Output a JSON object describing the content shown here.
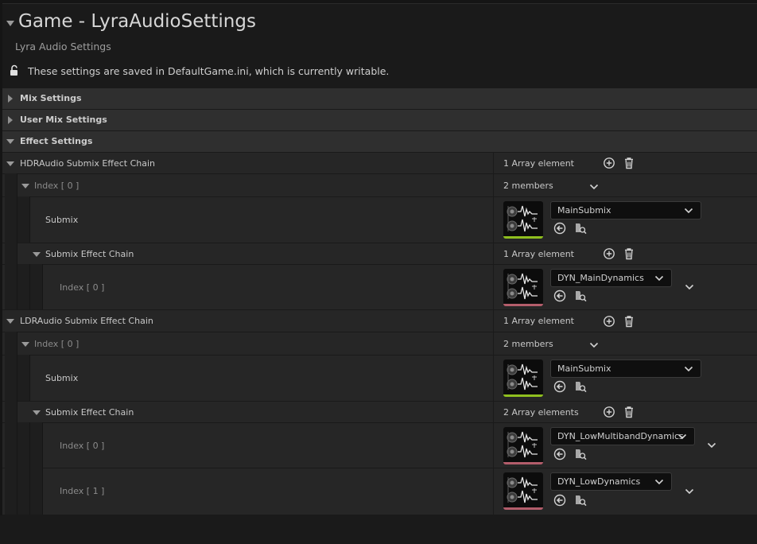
{
  "header": {
    "title": "Game - LyraAudioSettings",
    "subtitle": "Lyra Audio Settings",
    "notice": "These settings are saved in DefaultGame.ini, which is currently writable."
  },
  "categories": {
    "mix": "Mix Settings",
    "user_mix": "User Mix Settings",
    "effect": "Effect Settings"
  },
  "hdr": {
    "label": "HDRAudio Submix Effect Chain",
    "count": "1 Array element",
    "index_label": "Index [ 0 ]",
    "index_members": "2 members",
    "submix_label": "Submix",
    "submix_value": "MainSubmix",
    "chain_label": "Submix Effect Chain",
    "chain_count": "1 Array element",
    "chain_items": [
      {
        "label": "Index [ 0 ]",
        "value": "DYN_MainDynamics"
      }
    ]
  },
  "ldr": {
    "label": "LDRAudio Submix Effect Chain",
    "count": "1 Array element",
    "index_label": "Index [ 0 ]",
    "index_members": "2 members",
    "submix_label": "Submix",
    "submix_value": "MainSubmix",
    "chain_label": "Submix Effect Chain",
    "chain_count": "2 Array elements",
    "chain_items": [
      {
        "label": "Index [ 0 ]",
        "value": "DYN_LowMultibandDynamics"
      },
      {
        "label": "Index [ 1 ]",
        "value": "DYN_LowDynamics"
      }
    ]
  },
  "colors": {
    "submix_asset_bar": "#8fbf1f",
    "effect_asset_bar": "#b35d6b"
  },
  "icons": [
    "lock-open-icon",
    "add-element-icon",
    "delete-all-icon",
    "use-selected-icon",
    "browse-asset-icon",
    "chevron-down-icon",
    "submix-waveform-icon"
  ]
}
